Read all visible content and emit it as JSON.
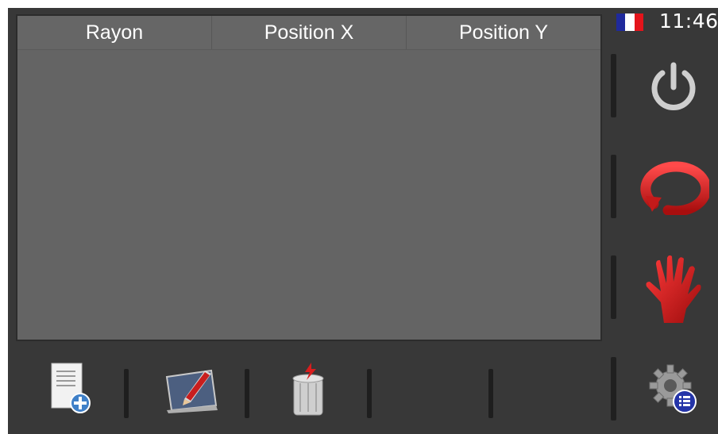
{
  "table": {
    "columns": [
      "Rayon",
      "Position X",
      "Position Y"
    ],
    "rows": []
  },
  "status": {
    "time": "11:46",
    "language_flag": "france-flag-icon",
    "flag_colors": [
      "#1f2a9c",
      "#ffffff",
      "#e4141b"
    ]
  },
  "side_toolbar": [
    {
      "icon": "power-icon"
    },
    {
      "icon": "reload-cycle-icon"
    },
    {
      "icon": "stop-hand-icon"
    },
    {
      "icon": "settings-list-icon"
    }
  ],
  "bottom_toolbar": [
    {
      "icon": "add-document-icon"
    },
    {
      "icon": "edit-pencil-icon"
    },
    {
      "icon": "delete-trash-icon"
    }
  ],
  "colors": {
    "background": "#383838",
    "table_bg": "#646464",
    "accent_red": "#d81d1d"
  }
}
